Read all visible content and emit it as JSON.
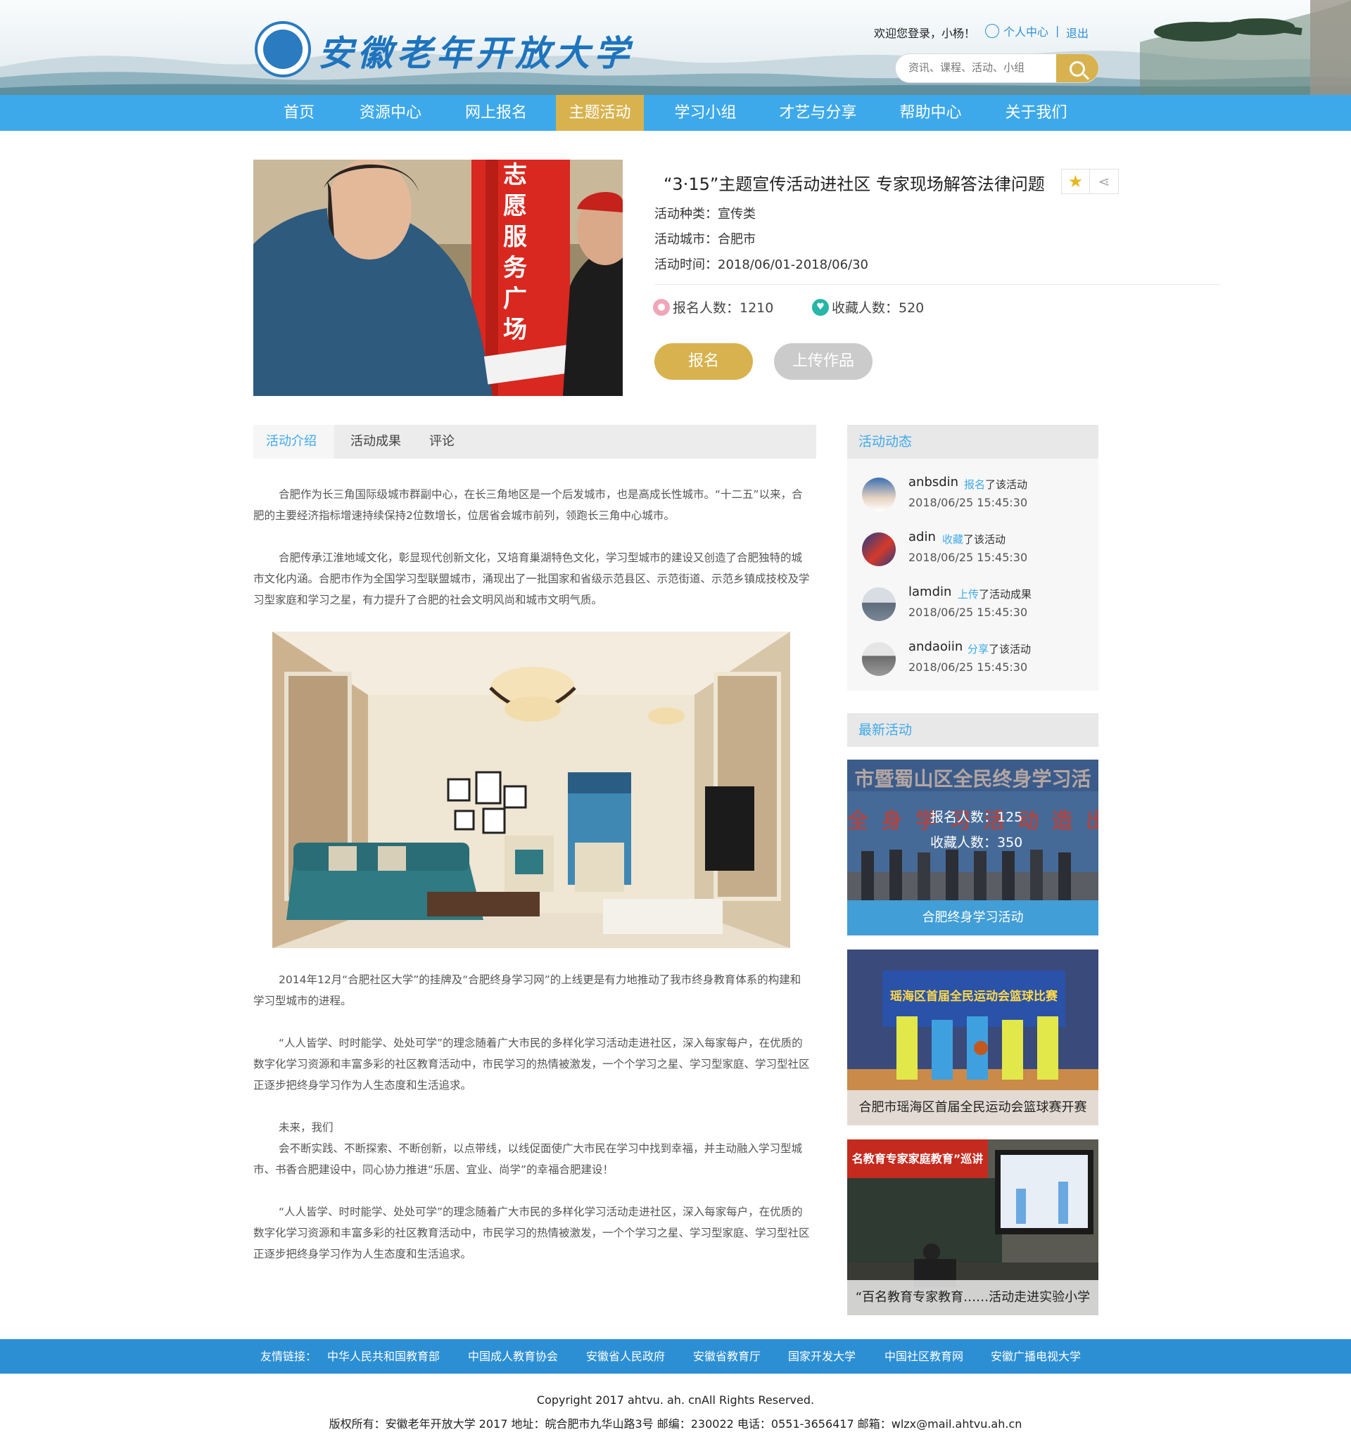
{
  "site": {
    "logo_text": "安徽老年开放大学",
    "welcome": "欢迎您登录，小杨！",
    "user_center": "个人中心",
    "separator": "|",
    "logout": "退出",
    "search_placeholder": "资讯、课程、活动、小组"
  },
  "nav": [
    "首页",
    "资源中心",
    "网上报名",
    "主题活动",
    "学习小组",
    "才艺与分享",
    "帮助中心",
    "关于我们"
  ],
  "nav_active": "主题活动",
  "activity": {
    "title": "“3·15”主题宣传活动进社区 专家现场解答法律问题",
    "type": "活动种类：宣传类",
    "city": "活动城市：合肥市",
    "time": "活动时间：2018/06/01-2018/06/30",
    "signups": "报名人数：1210",
    "favorites": "收藏人数：520",
    "signup_button": "报名",
    "upload_button": "上传作品",
    "photo_sign": [
      "志",
      "愿",
      "服",
      "务",
      "广",
      "场"
    ]
  },
  "tabs": [
    "活动介绍",
    "活动成果",
    "评论"
  ],
  "article": [
    "合肥作为长三角国际级城市群副中心，在长三角地区是一个后发城市，也是高成长性城市。“十二五”以来，合肥的主要经济指标增速持续保持2位数增长，位居省会城市前列，领跑长三角中心城市。",
    "合肥传承江淮地域文化，彰显现代创新文化，又培育巢湖特色文化，学习型城市的建设又创造了合肥独特的城市文化内涵。合肥市作为全国学习型联盟城市，涌现出了一批国家和省级示范县区、示范街道、示范乡镇成技校及学习型家庭和学习之星，有力提升了合肥的社会文明风尚和城市文明气质。",
    "2014年12月“合肥社区大学”的挂牌及“合肥终身学习网”的上线更是有力地推动了我市终身教育体系的构建和学习型城市的进程。",
    "“人人皆学、时时能学、处处可学”的理念随着广大市民的多样化学习活动走进社区，深入每家每户，在优质的数字化学习资源和丰富多彩的社区教育活动中，市民学习的热情被激发，一个个学习之星、学习型家庭、学习型社区正逐步把终身学习作为人生态度和生活追求。",
    "未来，我们",
    "会不断实践、不断探索、不断创新，以点带线，以线促面使广大市民在学习中找到幸福，并主动融入学习型城市、书香合肥建设中，同心协力推进“乐居、宜业、尚学”的幸福合肥建设！",
    "“人人皆学、时时能学、处处可学”的理念随着广大市民的多样化学习活动走进社区，深入每家每户，在优质的数字化学习资源和丰富多彩的社区教育活动中，市民学习的热情被激发，一个个学习之星、学习型家庭、学习型社区正逐步把终身学习作为人生态度和生活追求。"
  ],
  "sidebar": {
    "dynamics_title": "活动动态",
    "dynamics": [
      {
        "name": "anbsdin",
        "action": "报名",
        "suffix": "了该活动",
        "time": "2018/06/25  15:45:30"
      },
      {
        "name": "adin",
        "action": "收藏",
        "suffix": "了该活动",
        "time": "2018/06/25  15:45:30"
      },
      {
        "name": "lamdin",
        "action": "上传",
        "suffix": "了活动成果",
        "time": "2018/06/25  15:45:30"
      },
      {
        "name": "andaoiin",
        "action": "分享",
        "suffix": "了该活动",
        "time": "2018/06/25  15:45:30"
      }
    ],
    "latest_title": "最新活动",
    "latest": [
      {
        "caption": "合肥终身学习活动",
        "signups": "报名人数：125",
        "favorites": "收藏人数：350",
        "banner": "市暨蜀山区全民终身学习活",
        "banner2": "全 身 学 习 活 动 造 出 彩"
      },
      {
        "caption": "合肥市瑶海区首届全民运动会篮球赛开赛",
        "banner": "瑶海区首届全民运动会篮球比赛"
      },
      {
        "caption": "“百名教育专家教育……活动走进实验小学",
        "banner": "名教育专家家庭教育”巡讲"
      }
    ]
  },
  "footer": {
    "links_label": "友情链接：",
    "links": [
      "中华人民共和国教育部",
      "中国成人教育协会",
      "安徽省人民政府",
      "安徽省教育厅",
      "国家开发大学",
      "中国社区教育网",
      "安徽广播电视大学"
    ],
    "copyright": "Copyright 2017 ahtvu. ah. cnAll Rights Reserved.",
    "info": "版权所有：安徽老年开放大学 2017 地址：皖合肥市九华山路3号 邮编：230022 电话：0551-3656417 邮箱：wlzx@mail.ahtvu.ah.cn"
  },
  "colors": {
    "accent_blue": "#3ea9ea",
    "gold": "#d7b24e",
    "footer_blue": "#2c8fd4"
  }
}
